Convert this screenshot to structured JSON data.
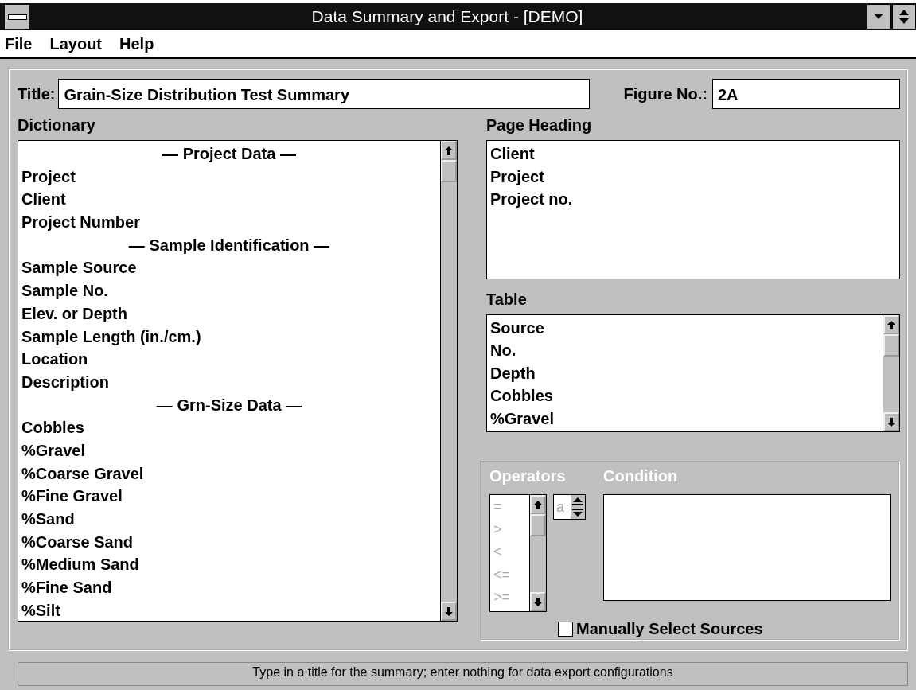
{
  "window": {
    "title": "Data Summary and Export - [DEMO]"
  },
  "menu": [
    {
      "label": "File"
    },
    {
      "label": "Layout"
    },
    {
      "label": "Help"
    }
  ],
  "title_field": {
    "label": "Title:",
    "value": "Grain-Size Distribution Test Summary"
  },
  "figure_field": {
    "label": "Figure No.:",
    "value": "2A"
  },
  "dictionary": {
    "label": "Dictionary",
    "items": [
      {
        "kind": "header",
        "text": "— Project Data —"
      },
      {
        "kind": "field",
        "text": "Project"
      },
      {
        "kind": "field",
        "text": "Client"
      },
      {
        "kind": "field",
        "text": "Project Number"
      },
      {
        "kind": "header",
        "text": "— Sample Identification —"
      },
      {
        "kind": "field",
        "text": "Sample Source"
      },
      {
        "kind": "field",
        "text": "Sample No."
      },
      {
        "kind": "field",
        "text": "Elev. or Depth"
      },
      {
        "kind": "field",
        "text": "Sample Length (in./cm.)"
      },
      {
        "kind": "field",
        "text": "Location"
      },
      {
        "kind": "field",
        "text": "Description"
      },
      {
        "kind": "header",
        "text": "— Grn-Size Data —"
      },
      {
        "kind": "field",
        "text": "Cobbles"
      },
      {
        "kind": "field",
        "text": "%Gravel"
      },
      {
        "kind": "field",
        "text": "%Coarse Gravel"
      },
      {
        "kind": "field",
        "text": "%Fine Gravel"
      },
      {
        "kind": "field",
        "text": "%Sand"
      },
      {
        "kind": "field",
        "text": "%Coarse Sand"
      },
      {
        "kind": "field",
        "text": "%Medium Sand"
      },
      {
        "kind": "field",
        "text": "%Fine Sand"
      },
      {
        "kind": "field",
        "text": "%Silt"
      }
    ]
  },
  "page_heading": {
    "label": "Page Heading",
    "items": [
      "Client",
      "Project",
      "Project no."
    ]
  },
  "table": {
    "label": "Table",
    "items": [
      "Source",
      "No.",
      "Depth",
      "Cobbles",
      "%Gravel"
    ]
  },
  "filter": {
    "operators_label": "Operators",
    "condition_label": "Condition",
    "disabled": true,
    "operators": [
      "=",
      ">",
      "<",
      "<=",
      ">="
    ],
    "spin_value": "a",
    "manual_select": {
      "label": "Manually Select Sources",
      "checked": false
    }
  },
  "status_bar": "Type in a title for the summary; enter nothing for data export configurations"
}
